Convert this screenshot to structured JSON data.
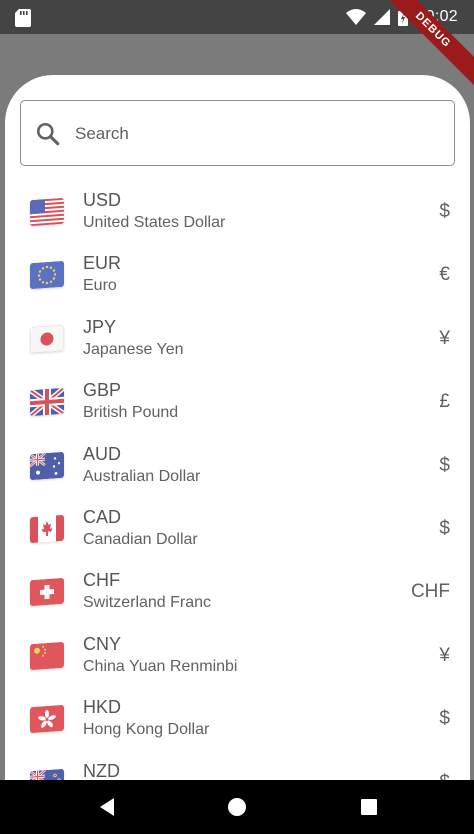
{
  "status_bar": {
    "time": "10:02",
    "icons": [
      "sd-card-icon",
      "wifi-icon",
      "cell-signal-icon",
      "battery-icon"
    ]
  },
  "debug_banner": "DEBUG",
  "search": {
    "placeholder": "Search",
    "value": "",
    "icon": "search-icon"
  },
  "currencies": [
    {
      "code": "USD",
      "name": "United States Dollar",
      "symbol": "$"
    },
    {
      "code": "EUR",
      "name": "Euro",
      "symbol": "€"
    },
    {
      "code": "JPY",
      "name": "Japanese Yen",
      "symbol": "¥"
    },
    {
      "code": "GBP",
      "name": "British Pound",
      "symbol": "£"
    },
    {
      "code": "AUD",
      "name": "Australian Dollar",
      "symbol": "$"
    },
    {
      "code": "CAD",
      "name": "Canadian Dollar",
      "symbol": "$"
    },
    {
      "code": "CHF",
      "name": "Switzerland Franc",
      "symbol": "CHF"
    },
    {
      "code": "CNY",
      "name": "China Yuan Renminbi",
      "symbol": "¥"
    },
    {
      "code": "HKD",
      "name": "Hong Kong Dollar",
      "symbol": "$"
    },
    {
      "code": "NZD",
      "name": "",
      "symbol": "$"
    }
  ],
  "nav_bar": [
    "back-icon",
    "home-icon",
    "recents-icon"
  ],
  "colors": {
    "status_bar": "#444444",
    "scrim": "#7b7b7b",
    "sheet": "#ffffff",
    "debug_ribbon": "#9b1b1b",
    "text_primary": "#555555"
  }
}
